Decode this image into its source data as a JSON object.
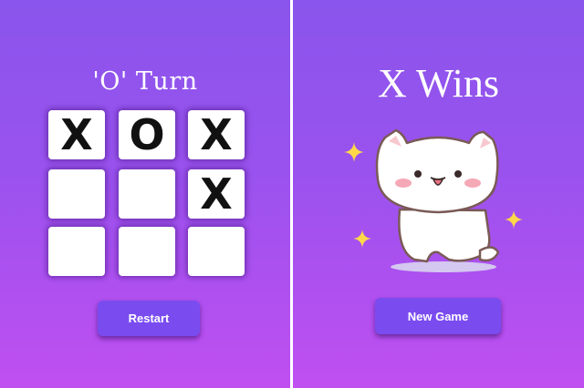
{
  "left_screen": {
    "turn_title": "'O' Turn",
    "board": [
      [
        "X",
        "O",
        "X"
      ],
      [
        "",
        "",
        "X"
      ],
      [
        "",
        "",
        ""
      ]
    ],
    "restart_label": "Restart"
  },
  "right_screen": {
    "result_title": "X Wins",
    "new_game_label": "New Game",
    "mascot_icon": "happy-cat-icon",
    "sparkle_icon": "sparkle-icon"
  },
  "colors": {
    "background_top": "#8a55ec",
    "background_bottom": "#c04ff1",
    "button": "#7a4cf0",
    "cell": "#ffffff",
    "mark": "#111111",
    "text": "#ffffff"
  }
}
